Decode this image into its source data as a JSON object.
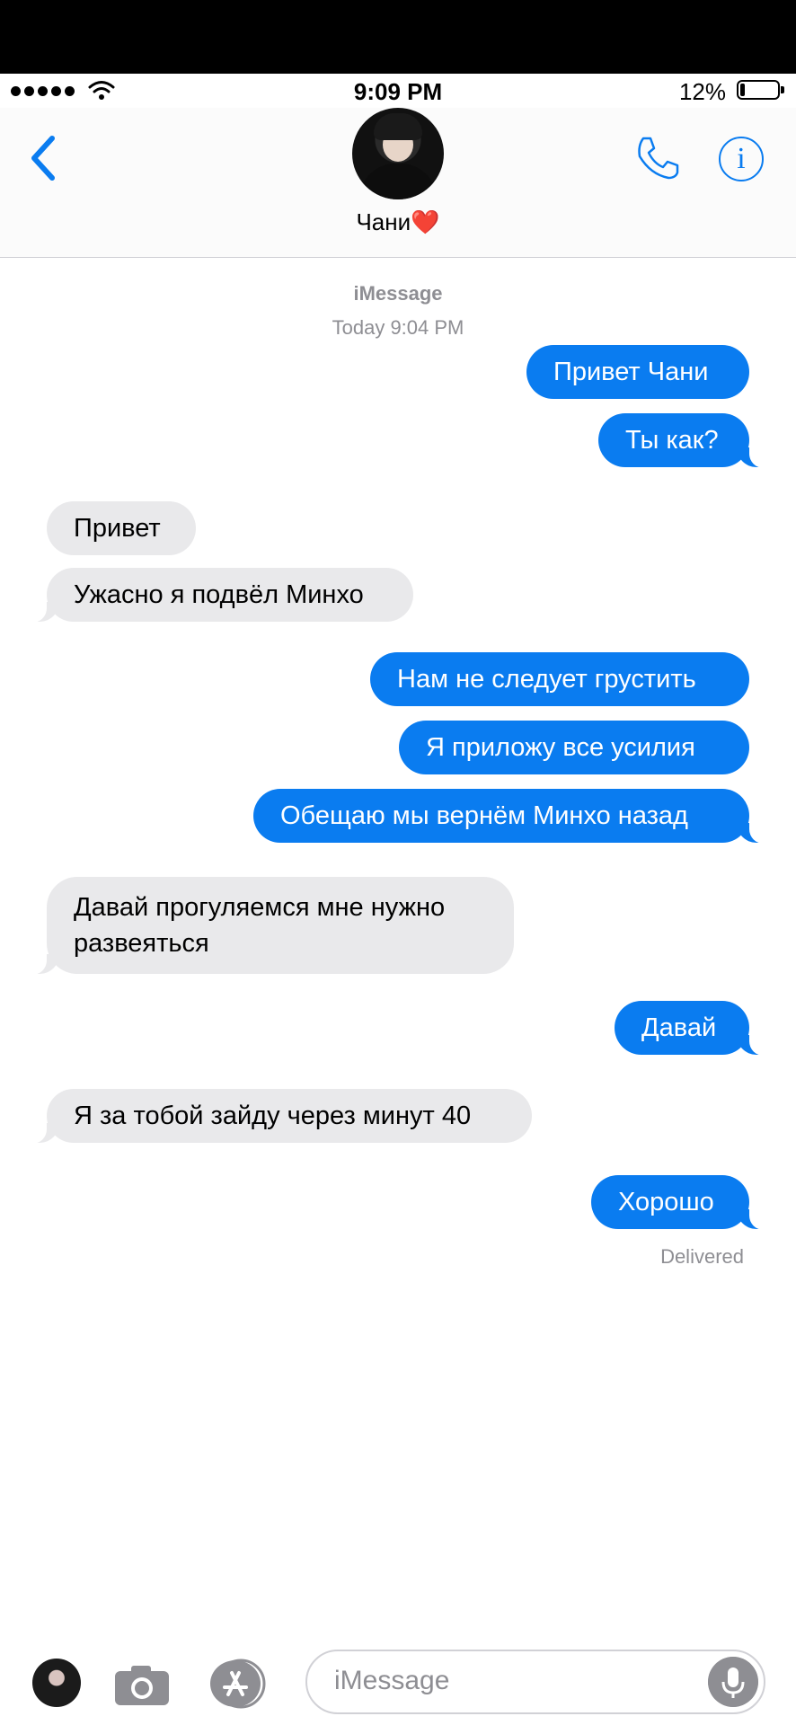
{
  "status_bar": {
    "time": "9:09 PM",
    "battery_percent": "12%",
    "battery_level": 0.12,
    "signal_icon": "signal-dots-icon",
    "wifi_icon": "wifi-icon"
  },
  "header": {
    "contact_name": "Чани❤️",
    "back_icon": "chevron-left-icon",
    "call_icon": "phone-icon",
    "info_icon": "info-icon",
    "info_glyph": "i"
  },
  "thread": {
    "service": "iMessage",
    "timestamp": "Today 9:04 PM",
    "messages": [
      {
        "from": "me",
        "text": "Привет Чани"
      },
      {
        "from": "me",
        "text": "Ты как?"
      },
      {
        "from": "them",
        "text": "Привет"
      },
      {
        "from": "them",
        "text": "Ужасно я подвёл Минхо"
      },
      {
        "from": "me",
        "text": "Нам не следует грустить"
      },
      {
        "from": "me",
        "text": "Я приложу все усилия"
      },
      {
        "from": "me",
        "text": "Обещаю мы вернём Минхо назад"
      },
      {
        "from": "them",
        "text": "Давай прогуляемся мне нужно",
        "text2": "развеяться"
      },
      {
        "from": "me",
        "text": "Давай"
      },
      {
        "from": "them",
        "text": "Я за тобой зайду через минут 40"
      },
      {
        "from": "me",
        "text": "Хорошо"
      }
    ],
    "delivered_label": "Delivered"
  },
  "composer": {
    "placeholder": "iMessage",
    "camera_icon": "camera-icon",
    "apps_icon": "app-store-icon",
    "mic_icon": "microphone-icon"
  },
  "colors": {
    "accent": "#0a7cf0",
    "outgoing_bubble": "#0a7cf0",
    "incoming_bubble": "#e9e9eb",
    "secondary_text": "#8e8e93"
  }
}
